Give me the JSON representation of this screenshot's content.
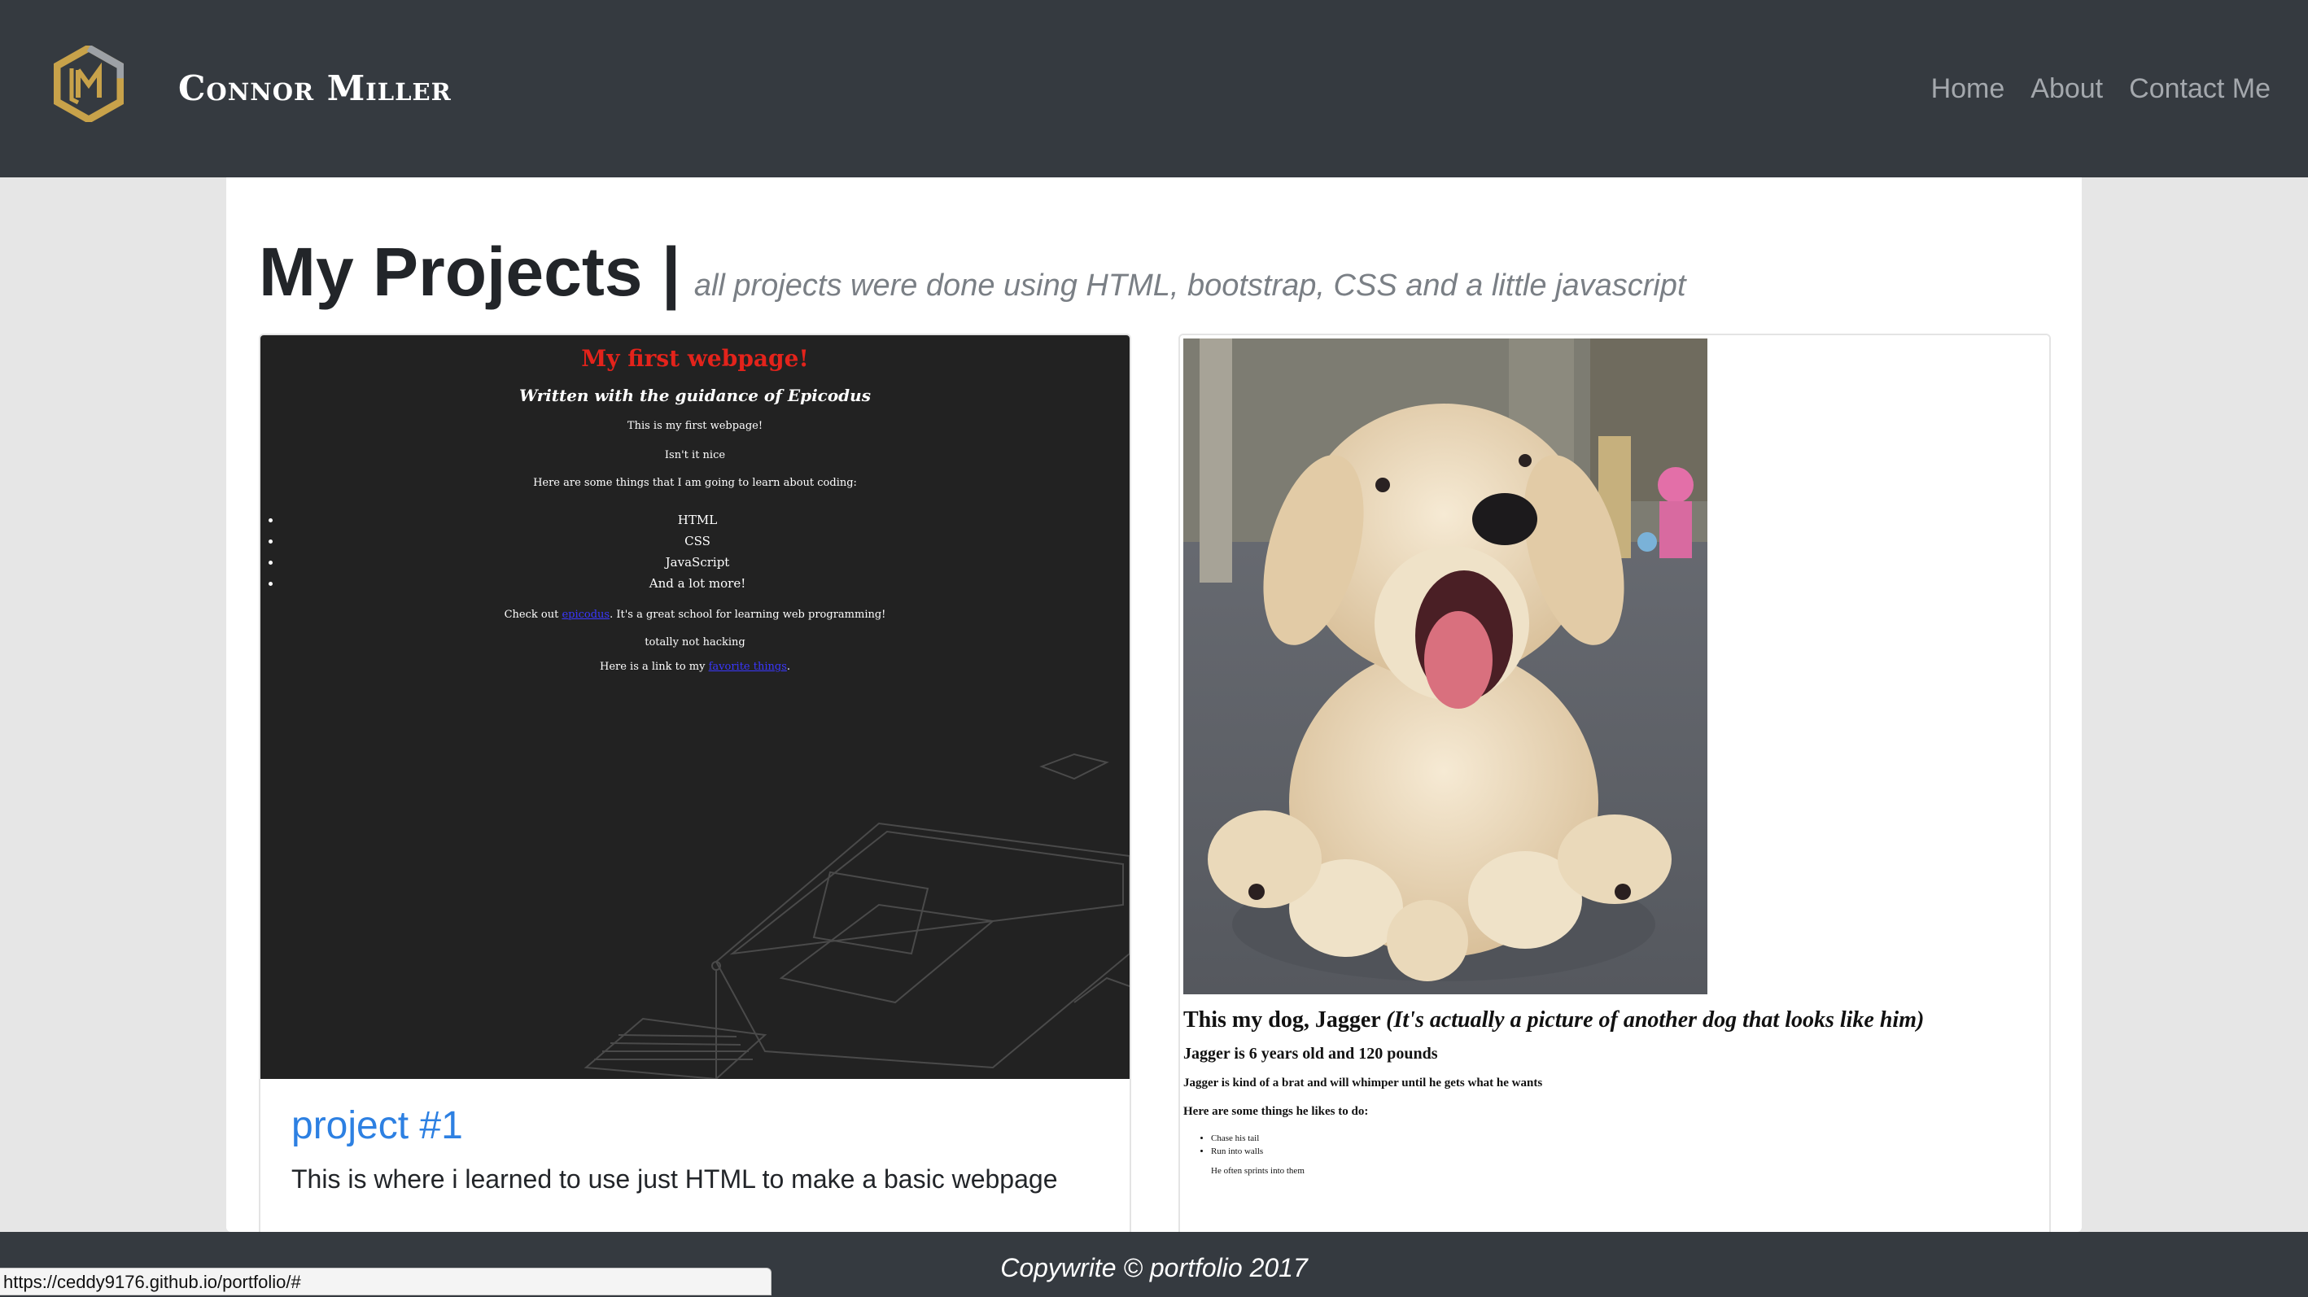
{
  "navbar": {
    "logo_icon": "cm-hexagon-logo-icon",
    "brand": "Connor Miller",
    "links": [
      "Home",
      "About",
      "Contact Me"
    ]
  },
  "page": {
    "title": "My Projects |",
    "subtitle": "all projects were done using HTML, bootstrap, CSS and a little javascript"
  },
  "projects": [
    {
      "screenshot": {
        "heading": "My first webpage!",
        "subheading": "Written with the guidance of Epicodus",
        "lines": [
          "This is my first webpage!",
          "Isn't it nice",
          "Here are some things that I am going to learn about coding:"
        ],
        "list": [
          "HTML",
          "CSS",
          "JavaScript",
          "And a lot more!"
        ],
        "check_pre": "Check out ",
        "check_link": "epicodus",
        "check_post": ". It's a great school for learning web programming!",
        "hacking": "totally not hacking",
        "link_pre": "Here is a link to my ",
        "link_text": "favorite things",
        "link_post": "."
      },
      "title": "project #1",
      "description": "This is where i learned to use just HTML to make a basic webpage"
    },
    {
      "screenshot": {
        "heading_main": "This my dog, Jagger ",
        "heading_italic": "(It's actually a picture of another dog that looks like him)",
        "age": "Jagger is 6 years old and 120 pounds",
        "behavior": "Jagger is kind of a brat and will whimper until he gets what he wants",
        "likes_intro": "Here are some things he likes to do:",
        "likes": [
          "Chase his tail",
          "Run into walls"
        ],
        "note": "He often sprints into them"
      }
    }
  ],
  "footer": {
    "text": "Copywrite © portfolio 2017"
  },
  "status_bar": {
    "url": "https://ceddy9176.github.io/portfolio/#"
  },
  "colors": {
    "navbar": "#353a40",
    "link_blue": "#2d80e2",
    "panel": "#ffffff",
    "background": "#e6e6e6"
  }
}
